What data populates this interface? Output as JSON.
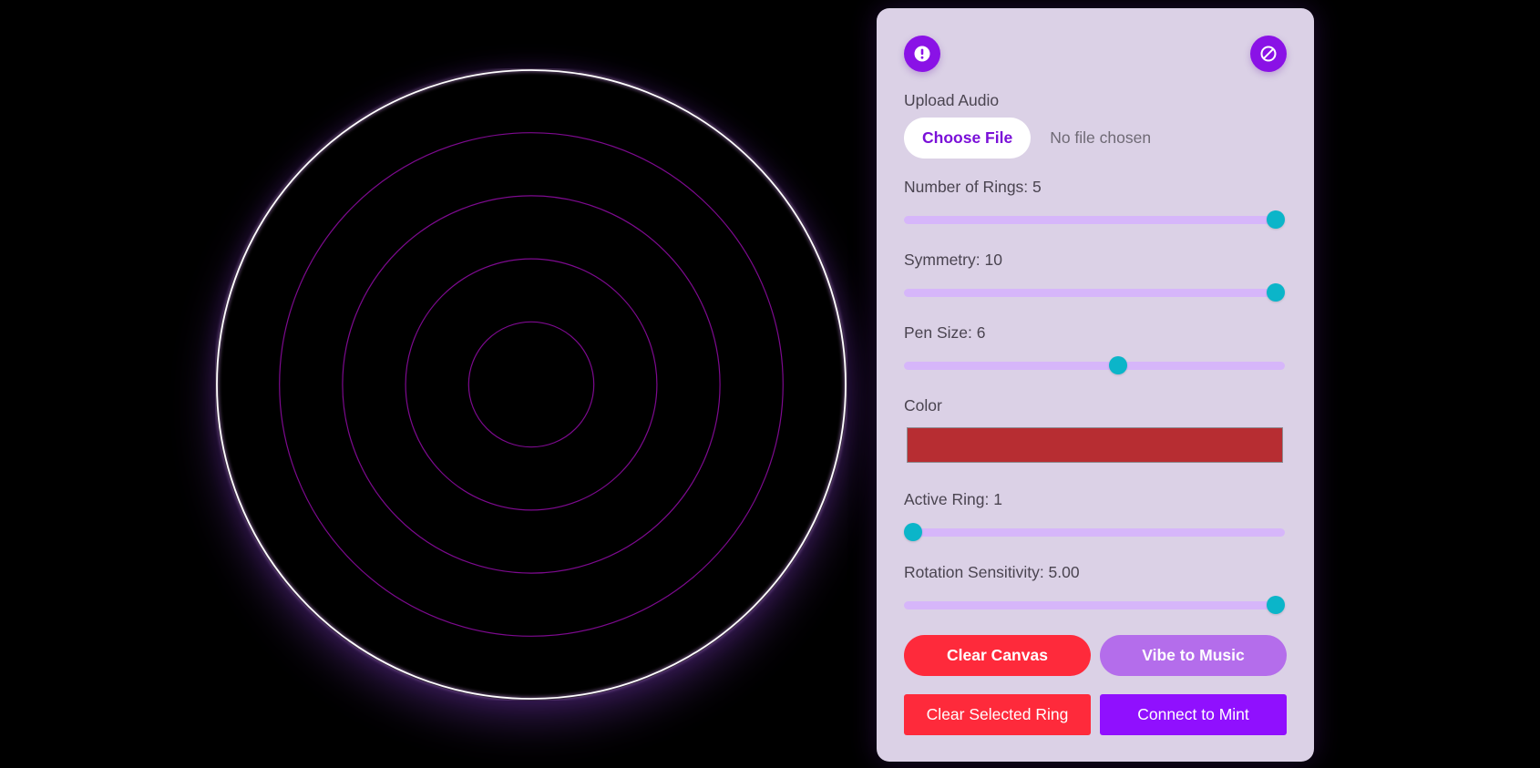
{
  "canvas": {
    "ring_count": 5,
    "active_ring": 1,
    "colors": {
      "background": "#000000",
      "active_ring": "#ffffff",
      "active_ring_glow": "#e0a6ff",
      "inactive_ring": "#7d0a8f"
    }
  },
  "panel": {
    "info_icon": "info-icon",
    "ban_icon": "ban-icon",
    "upload": {
      "label": "Upload Audio",
      "button": "Choose File",
      "status": "No file chosen"
    },
    "controls": {
      "rings": {
        "label": "Number of Rings: 5",
        "value": 5,
        "min": 1,
        "max": 5,
        "fraction": 1.0
      },
      "symmetry": {
        "label": "Symmetry: 10",
        "value": 10,
        "min": 1,
        "max": 10,
        "fraction": 1.0
      },
      "pen_size": {
        "label": "Pen Size: 6",
        "value": 6,
        "min": 1,
        "max": 10,
        "fraction": 0.565
      },
      "color": {
        "label": "Color",
        "value": "#b72d32"
      },
      "active_ring": {
        "label": "Active Ring: 1",
        "value": 1,
        "min": 1,
        "max": 5,
        "fraction": 0.0
      },
      "rotation": {
        "label": "Rotation Sensitivity: 5.00",
        "value": 5.0,
        "min": 0,
        "max": 5,
        "fraction": 1.0
      }
    },
    "buttons": {
      "clear_canvas": {
        "label": "Clear Canvas",
        "color": "#fe2a3b"
      },
      "vibe": {
        "label": "Vibe to Music",
        "color": "#b46deb"
      },
      "clear_ring": {
        "label": "Clear Selected Ring",
        "color": "#fe2a3b"
      },
      "mint": {
        "label": "Connect to Mint",
        "color": "#9010fe"
      }
    }
  }
}
